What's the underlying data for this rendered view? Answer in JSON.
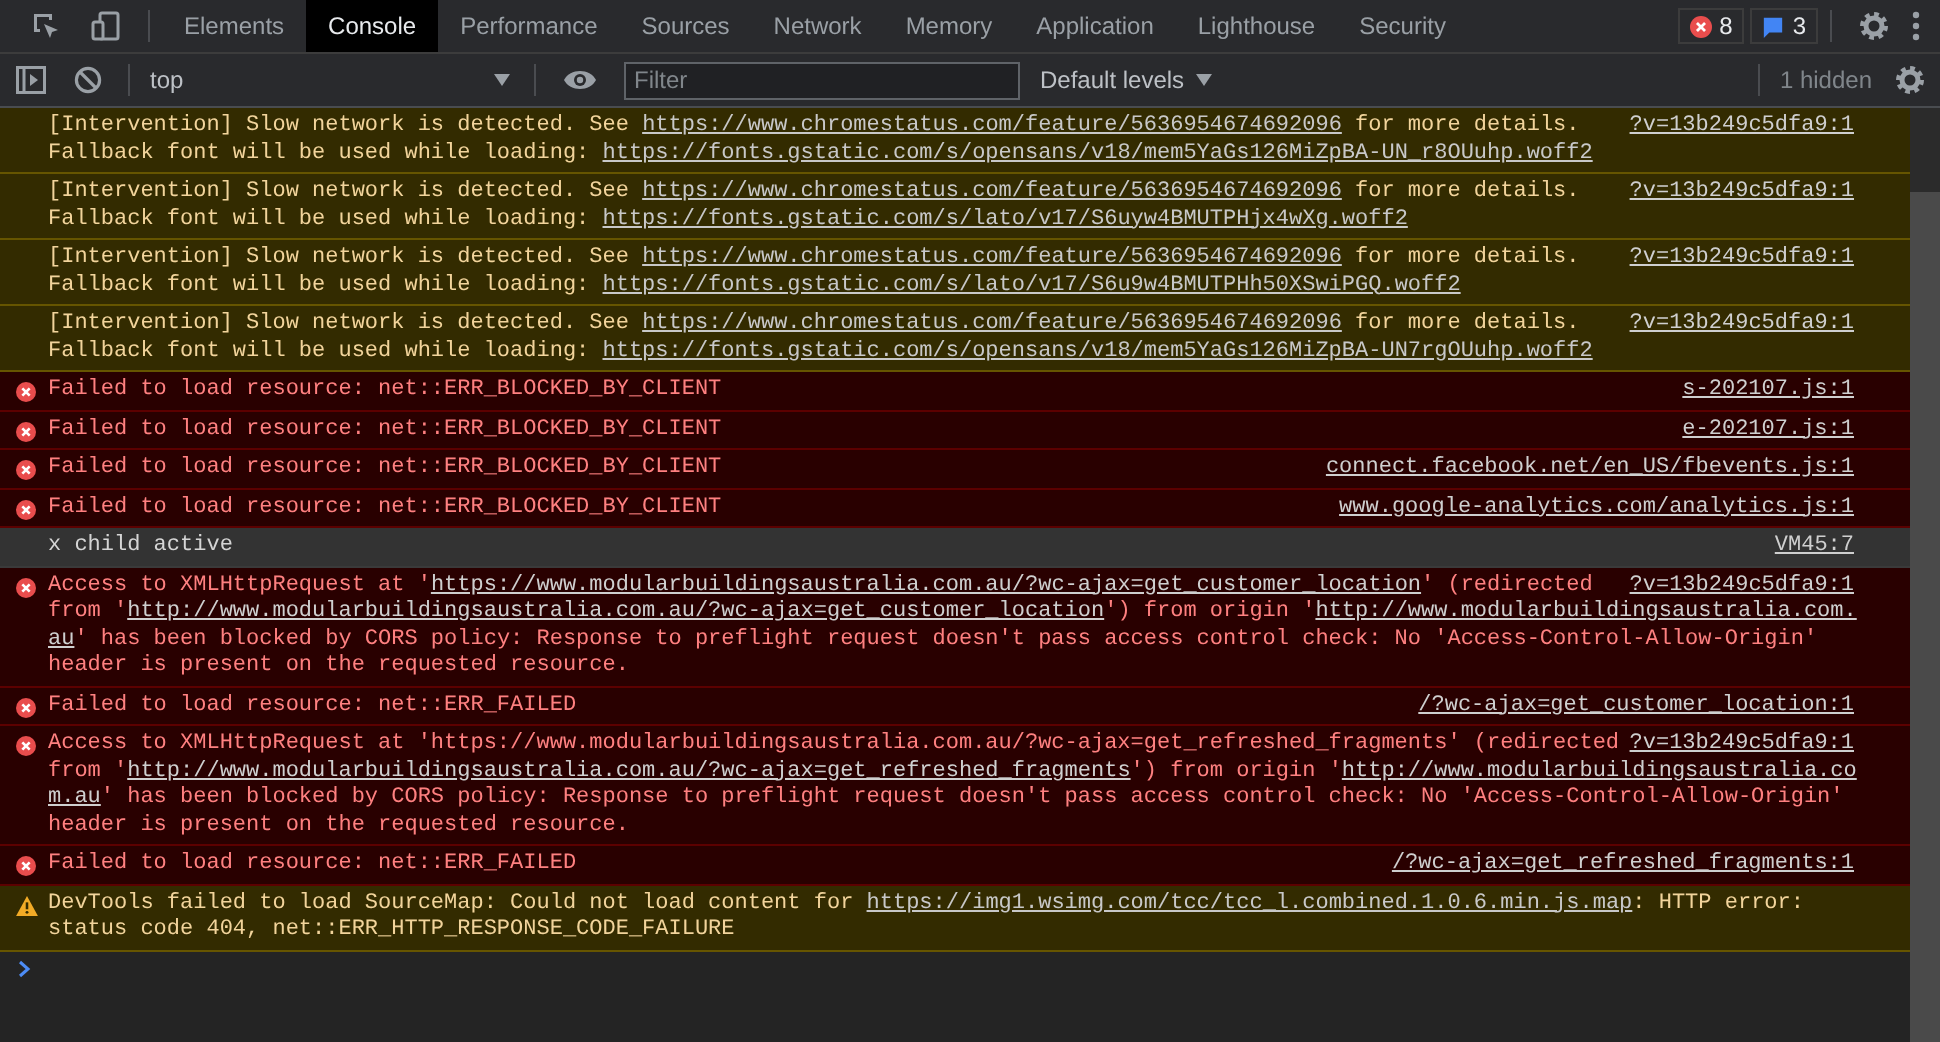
{
  "tabs": [
    {
      "label": "Elements",
      "selected": false
    },
    {
      "label": "Console",
      "selected": true
    },
    {
      "label": "Performance",
      "selected": false
    },
    {
      "label": "Sources",
      "selected": false
    },
    {
      "label": "Network",
      "selected": false
    },
    {
      "label": "Memory",
      "selected": false
    },
    {
      "label": "Application",
      "selected": false
    },
    {
      "label": "Lighthouse",
      "selected": false
    },
    {
      "label": "Security",
      "selected": false
    }
  ],
  "error_count": "8",
  "message_count": "3",
  "toolbar": {
    "context": "top",
    "filter_placeholder": "Filter",
    "levels": "Default levels",
    "hidden": "1 hidden"
  },
  "messages": [
    {
      "kind": "intervention",
      "source": "?v=13b249c5dfa9:1",
      "lines": [
        [
          {
            "text": "[Intervention] Slow network is detected. See ",
            "link": false
          },
          {
            "text": "https://www.chromestatus.com/feature/5636954674692096",
            "link": true
          },
          {
            "text": " for more details.",
            "link": false
          }
        ],
        [
          {
            "text": "Fallback font will be used while loading: ",
            "link": false
          },
          {
            "text": "https://fonts.gstatic.com/s/opensans/v18/mem5YaGs126MiZpBA-UN_r8OUuhp.woff2",
            "link": true
          }
        ]
      ]
    },
    {
      "kind": "intervention",
      "source": "?v=13b249c5dfa9:1",
      "lines": [
        [
          {
            "text": "[Intervention] Slow network is detected. See ",
            "link": false
          },
          {
            "text": "https://www.chromestatus.com/feature/5636954674692096",
            "link": true
          },
          {
            "text": " for more details.",
            "link": false
          }
        ],
        [
          {
            "text": "Fallback font will be used while loading: ",
            "link": false
          },
          {
            "text": "https://fonts.gstatic.com/s/lato/v17/S6uyw4BMUTPHjx4wXg.woff2",
            "link": true
          }
        ]
      ]
    },
    {
      "kind": "intervention",
      "source": "?v=13b249c5dfa9:1",
      "lines": [
        [
          {
            "text": "[Intervention] Slow network is detected. See ",
            "link": false
          },
          {
            "text": "https://www.chromestatus.com/feature/5636954674692096",
            "link": true
          },
          {
            "text": " for more details.",
            "link": false
          }
        ],
        [
          {
            "text": "Fallback font will be used while loading: ",
            "link": false
          },
          {
            "text": "https://fonts.gstatic.com/s/lato/v17/S6u9w4BMUTPHh50XSwiPGQ.woff2",
            "link": true
          }
        ]
      ]
    },
    {
      "kind": "intervention",
      "source": "?v=13b249c5dfa9:1",
      "lines": [
        [
          {
            "text": "[Intervention] Slow network is detected. See ",
            "link": false
          },
          {
            "text": "https://www.chromestatus.com/feature/5636954674692096",
            "link": true
          },
          {
            "text": " for more details.",
            "link": false
          }
        ],
        [
          {
            "text": "Fallback font will be used while loading: ",
            "link": false
          },
          {
            "text": "https://fonts.gstatic.com/s/opensans/v18/mem5YaGs126MiZpBA-UN7rgOUuhp.woff2",
            "link": true
          }
        ]
      ]
    },
    {
      "kind": "error",
      "source": "s-202107.js:1",
      "lines": [
        [
          {
            "text": "Failed to load resource: net::ERR_BLOCKED_BY_CLIENT",
            "link": false
          }
        ]
      ]
    },
    {
      "kind": "error",
      "source": "e-202107.js:1",
      "lines": [
        [
          {
            "text": "Failed to load resource: net::ERR_BLOCKED_BY_CLIENT",
            "link": false
          }
        ]
      ]
    },
    {
      "kind": "error",
      "source": "connect.facebook.net/en_US/fbevents.js:1",
      "lines": [
        [
          {
            "text": "Failed to load resource: net::ERR_BLOCKED_BY_CLIENT",
            "link": false
          }
        ]
      ]
    },
    {
      "kind": "error",
      "source": "www.google-analytics.com/analytics.js:1",
      "lines": [
        [
          {
            "text": "Failed to load resource: net::ERR_BLOCKED_BY_CLIENT",
            "link": false
          }
        ]
      ]
    },
    {
      "kind": "log",
      "source": "VM45:7",
      "lines": [
        [
          {
            "text": "x child active",
            "link": false
          }
        ]
      ]
    },
    {
      "kind": "error",
      "source": "?v=13b249c5dfa9:1",
      "lines": [
        [
          {
            "text": "Access to XMLHttpRequest at '",
            "link": false
          },
          {
            "text": "https://www.modularbuildingsaustralia.com.au/?wc-ajax=get_customer_location",
            "link": true
          },
          {
            "text": "' (redirected",
            "link": false
          }
        ],
        [
          {
            "text": "from '",
            "link": false
          },
          {
            "text": "http://www.modularbuildingsaustralia.com.au/?wc-ajax=get_customer_location",
            "link": true
          },
          {
            "text": "') from origin '",
            "link": false
          },
          {
            "text": "http://www.modularbuildingsaustralia.com.",
            "link": true
          }
        ],
        [
          {
            "text": "au",
            "link": true
          },
          {
            "text": "' has been blocked by CORS policy: Response to preflight request doesn't pass access control check: No 'Access-Control-Allow-Origin'",
            "link": false
          }
        ],
        [
          {
            "text": "header is present on the requested resource.",
            "link": false
          }
        ]
      ]
    },
    {
      "kind": "error",
      "source": "/?wc-ajax=get_customer_location:1",
      "lines": [
        [
          {
            "text": "Failed to load resource: net::ERR_FAILED",
            "link": false
          }
        ]
      ]
    },
    {
      "kind": "error",
      "source": "?v=13b249c5dfa9:1",
      "lines": [
        [
          {
            "text": "Access to XMLHttpRequest at 'https://www.modularbuildingsaustralia.com.au/?wc-ajax=get_refreshed_fragments' (redirected",
            "link": false
          }
        ],
        [
          {
            "text": "from '",
            "link": false
          },
          {
            "text": "http://www.modularbuildingsaustralia.com.au/?wc-ajax=get_refreshed_fragments",
            "link": true
          },
          {
            "text": "') from origin '",
            "link": false
          },
          {
            "text": "http://www.modularbuildingsaustralia.co",
            "link": true
          }
        ],
        [
          {
            "text": "m.au",
            "link": true
          },
          {
            "text": "' has been blocked by CORS policy: Response to preflight request doesn't pass access control check: No 'Access-Control-Allow-Origin'",
            "link": false
          }
        ],
        [
          {
            "text": "header is present on the requested resource.",
            "link": false
          }
        ]
      ]
    },
    {
      "kind": "error",
      "source": "/?wc-ajax=get_refreshed_fragments:1",
      "lines": [
        [
          {
            "text": "Failed to load resource: net::ERR_FAILED",
            "link": false
          }
        ]
      ]
    },
    {
      "kind": "warning",
      "lines": [
        [
          {
            "text": "DevTools failed to load SourceMap: Could not load content for ",
            "link": false
          },
          {
            "text": "https://img1.wsimg.com/tcc/tcc_l.combined.1.0.6.min.js.map",
            "link": true
          },
          {
            "text": ": HTTP error:",
            "link": false
          }
        ],
        [
          {
            "text": "status code 404, net::ERR_HTTP_RESPONSE_CODE_FAILURE",
            "link": false
          }
        ]
      ]
    }
  ]
}
